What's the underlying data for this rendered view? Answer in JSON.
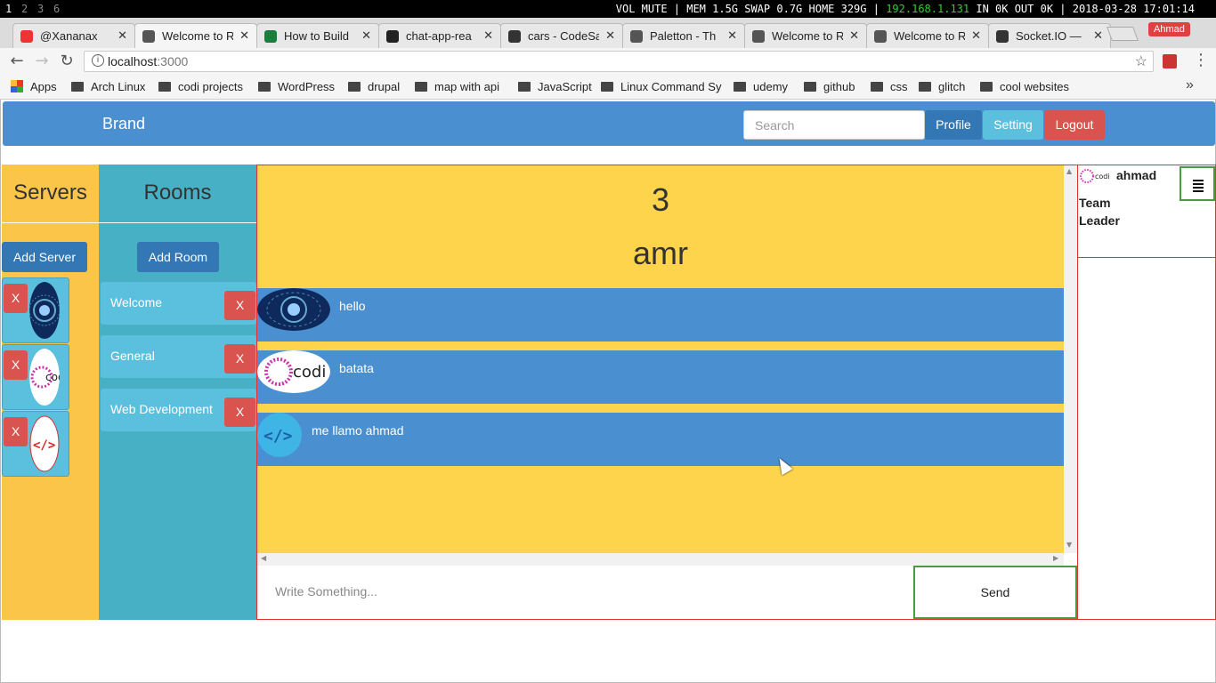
{
  "statusbar": {
    "workspaces": [
      "1",
      "2",
      "3",
      "6"
    ],
    "status_text": "VOL MUTE | MEM 1.5G  SWAP 0.7G  HOME 329G |",
    "ip": "192.168.1.131",
    "status_tail": "IN 0K OUT 0K | 2018-03-28 17:01:14"
  },
  "tabs": [
    {
      "label": "@Xananax",
      "icon": "youtube-icon",
      "color": "#e33"
    },
    {
      "label": "Welcome to R",
      "icon": "react-icon",
      "color": "#555"
    },
    {
      "label": "How to Build",
      "icon": "sheets-icon",
      "color": "#1a7f3c"
    },
    {
      "label": "chat-app-rea",
      "icon": "github-icon",
      "color": "#222"
    },
    {
      "label": "cars - CodeSa",
      "icon": "codesandbox-icon",
      "color": "#333"
    },
    {
      "label": "Paletton - Th",
      "icon": "paletton-icon",
      "color": "#555"
    },
    {
      "label": "Welcome to R",
      "icon": "react-icon",
      "color": "#555"
    },
    {
      "label": "Welcome to R",
      "icon": "react-icon",
      "color": "#555"
    },
    {
      "label": "Socket.IO —",
      "icon": "socketio-icon",
      "color": "#333"
    }
  ],
  "profile_badge": "Ahmad",
  "address": {
    "host": "localhost",
    "port": ":3000"
  },
  "bookmarks": [
    {
      "label": "Apps",
      "type": "apps"
    },
    {
      "label": "Arch Linux",
      "type": "folder"
    },
    {
      "label": "codi projects",
      "type": "folder"
    },
    {
      "label": "WordPress",
      "type": "folder"
    },
    {
      "label": "drupal",
      "type": "folder"
    },
    {
      "label": "map with api",
      "type": "folder"
    },
    {
      "label": "JavaScript",
      "type": "folder"
    },
    {
      "label": "Linux Command Sy",
      "type": "folder"
    },
    {
      "label": "udemy",
      "type": "folder"
    },
    {
      "label": "github",
      "type": "folder"
    },
    {
      "label": "css",
      "type": "folder"
    },
    {
      "label": "glitch",
      "type": "folder"
    },
    {
      "label": "cool websites",
      "type": "folder"
    }
  ],
  "navbar": {
    "brand": "Brand",
    "search_placeholder": "Search",
    "profile": "Profile",
    "setting": "Setting",
    "logout": "Logout"
  },
  "servers": {
    "title": "Servers",
    "add_label": "Add Server",
    "remove_label": "X",
    "items": [
      "server-tech",
      "server-codi",
      "server-code"
    ]
  },
  "rooms": {
    "title": "Rooms",
    "add_label": "Add Room",
    "remove_label": "X",
    "items": [
      "Welcome",
      "General",
      "Web Development"
    ]
  },
  "chat": {
    "count": "3",
    "room_user": "amr",
    "messages": [
      {
        "text": "hello",
        "avatar": "tech"
      },
      {
        "text": "batata",
        "avatar": "codi"
      },
      {
        "text": "me llamo ahmad",
        "avatar": "code"
      }
    ],
    "input_placeholder": "Write Something...",
    "send_label": "Send"
  },
  "user_panel": {
    "name": "ahmad",
    "role": "Team Leader",
    "avatar_text": "codi"
  },
  "colors": {
    "navbar": "#4a8fcf",
    "servers_bg": "#fbc54a",
    "rooms_bg": "#48b0c4",
    "chat_bg": "#fed44c",
    "danger": "#d9534f",
    "primary": "#3377b5",
    "info": "#5bc0de"
  }
}
